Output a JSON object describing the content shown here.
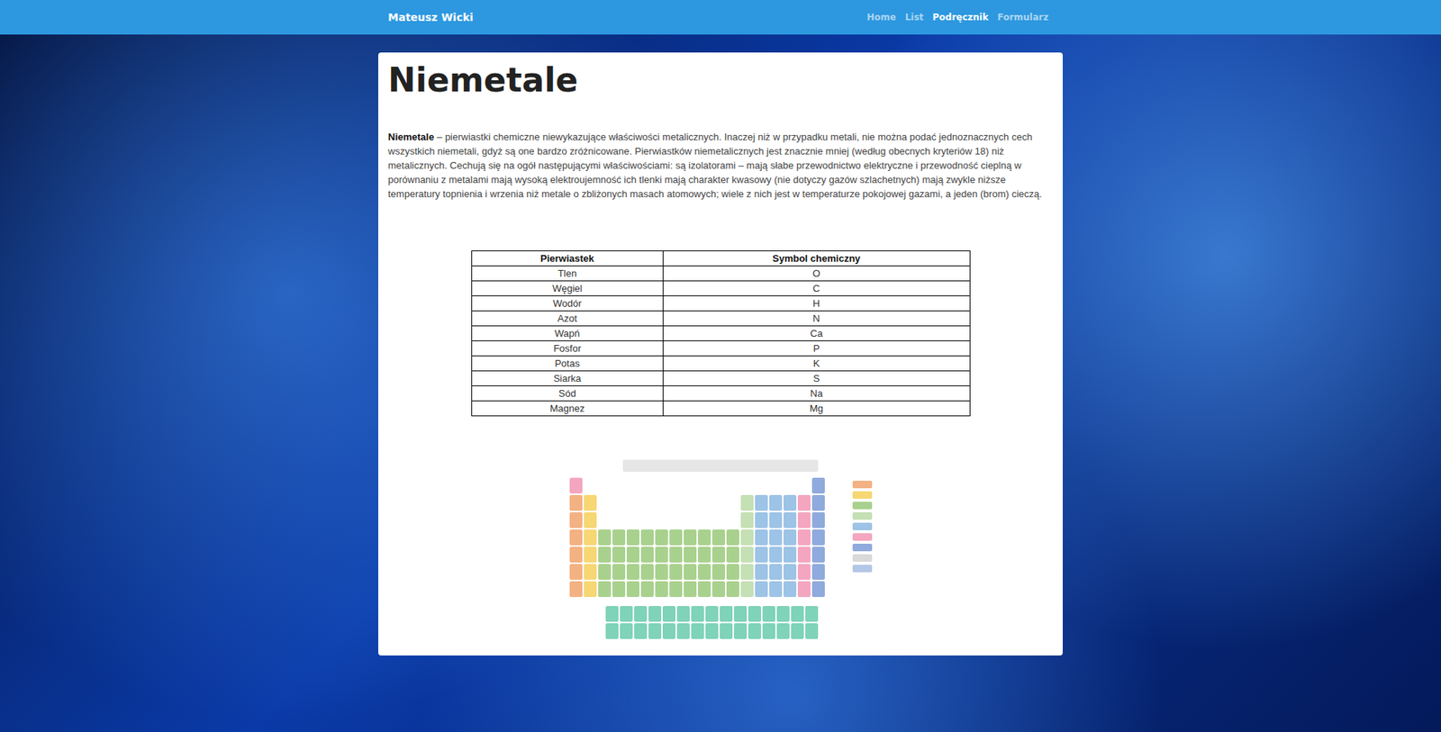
{
  "navbar": {
    "brand": "Mateusz Wicki",
    "links": [
      {
        "label": "Home",
        "selected": false
      },
      {
        "label": "List",
        "selected": false
      },
      {
        "label": "Podręcznik",
        "selected": true
      },
      {
        "label": "Formularz",
        "selected": false
      }
    ]
  },
  "page": {
    "title": "Niemetale",
    "term": "Niemetale",
    "text": "– pierwiastki chemiczne niewykazujące właściwości metalicznych. Inaczej niż w przypadku metali, nie można podać jednoznacznych cech wszystkich niemetali, gdyż są one bardzo zróżnicowane. Pierwiastków niemetalicznych jest znacznie mniej (według obecnych kryteriów 18) niż metalicznych. Cechują się na ogół następującymi właściwościami: są izolatorami – mają słabe przewodnictwo elektryczne i przewodność cieplną w porównaniu z metalami mają wysoką elektroujemność ich tlenki mają charakter kwasowy (nie dotyczy gazów szlachetnych) mają zwykle niższe temperatury topnienia i wrzenia niż metale o zbliżonych masach atomowych; wiele z nich jest w temperaturze pokojowej gazami, a jeden (brom) cieczą."
  },
  "table": {
    "columns": [
      "Pierwiastek",
      "Symbol chemiczny"
    ],
    "rows": [
      [
        "Tlen",
        "O"
      ],
      [
        "Węgiel",
        "C"
      ],
      [
        "Wodór",
        "H"
      ],
      [
        "Azot",
        "N"
      ],
      [
        "Wapń",
        "Ca"
      ],
      [
        "Fosfor",
        "P"
      ],
      [
        "Potas",
        "K"
      ],
      [
        "Siarka",
        "S"
      ],
      [
        "Sód",
        "Na"
      ],
      [
        "Magnez",
        "Mg"
      ]
    ]
  }
}
